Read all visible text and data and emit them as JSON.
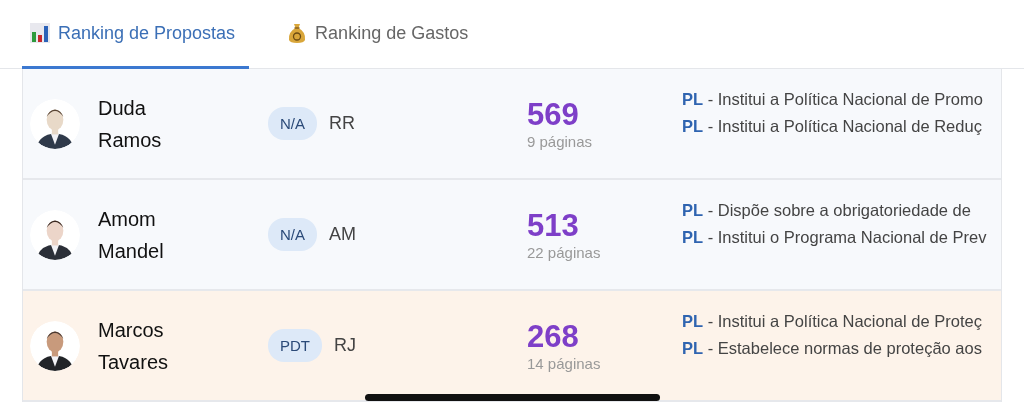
{
  "tabs": [
    {
      "label": "Ranking de Propostas",
      "selected": true
    },
    {
      "label": "Ranking de Gastos",
      "selected": false
    }
  ],
  "rows": [
    {
      "name": "Duda Ramos",
      "party": "N/A",
      "state": "RR",
      "count": "569",
      "pages": "9 páginas",
      "highlighted": false,
      "avatar": {
        "kind": "picture"
      },
      "proposals": [
        "**PL** - Institui a Política Nacional de Promo",
        "**PL** - Institui a Política Nacional de Reduç"
      ]
    },
    {
      "name": "Amom Mandel",
      "party": "N/A",
      "state": "AM",
      "count": "513",
      "pages": "22 páginas",
      "highlighted": false,
      "avatar": {
        "kind": "picture"
      },
      "proposals": [
        "**PL** - Dispõe sobre a obrigatoriedade de",
        "**PL** - Institui o Programa Nacional de Prev"
      ]
    },
    {
      "name": "Marcos Tavares",
      "party": "PDT",
      "state": "RJ",
      "count": "268",
      "pages": "14 páginas",
      "highlighted": true,
      "avatar": {
        "kind": "picture"
      },
      "proposals": [
        "**PL** - Institui a Política Nacional de Proteç",
        "**PL** - Estabelece normas de proteção aos"
      ]
    }
  ]
}
